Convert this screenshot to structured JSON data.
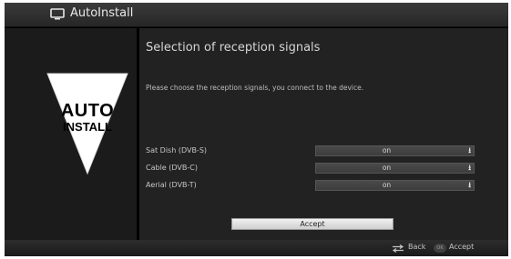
{
  "app": {
    "title": "AutoInstall",
    "icon": "tv-icon"
  },
  "logo": {
    "line1": "AUTO",
    "line2": "INSTALL"
  },
  "main": {
    "heading": "Selection of reception signals",
    "instruction": "Please choose the reception signals, you connect to the device.",
    "options": [
      {
        "label": "Sat Dish (DVB-S)",
        "value": "on"
      },
      {
        "label": "Cable (DVB-C)",
        "value": "on"
      },
      {
        "label": "Aerial (DVB-T)",
        "value": "on"
      }
    ],
    "accept_label": "Accept"
  },
  "footer": {
    "back_label": "Back",
    "ok_key": "OK",
    "accept_label": "Accept"
  },
  "colors": {
    "background": "#000000",
    "panel": "#222222",
    "left_panel": "#1b1b1b",
    "text": "#d6d6d6",
    "button": "#e6e6e6"
  }
}
